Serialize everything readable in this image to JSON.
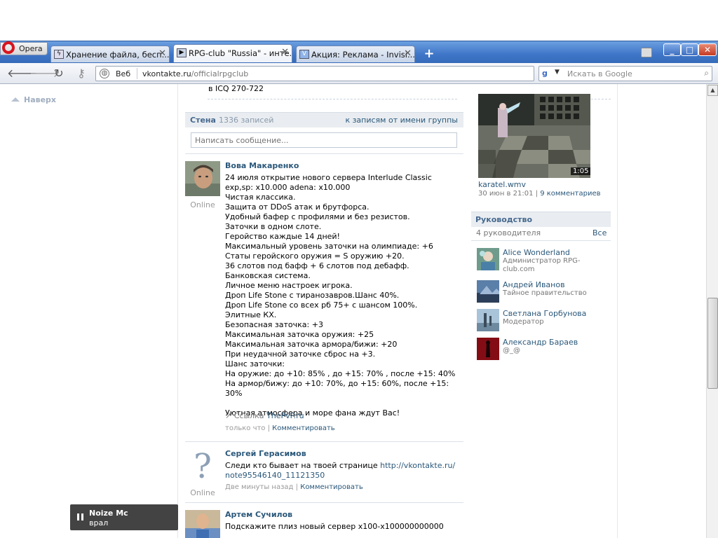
{
  "browser": {
    "menu_label": "Opera",
    "tabs": [
      {
        "title": "Хранение файла, бесп...",
        "favicon": "lightning-favicon-icon"
      },
      {
        "title": "RPG-club \"Russia\" - инте...",
        "favicon": "vk-favicon-icon"
      },
      {
        "title": "Акция: Реклама - Invisi...",
        "favicon": "v-favicon-icon"
      }
    ],
    "address": {
      "scheme_label": "Веб",
      "url_domain": "vkontakte.ru",
      "url_path": "/officialrpgclub"
    },
    "search_placeholder": "Искать в Google"
  },
  "page": {
    "back_to_top": "Наверх",
    "icq_line": "в ICQ 270-722",
    "wall": {
      "title": "Стена",
      "count": "1336 записей",
      "from_group_link": "к записям от имени группы",
      "input_placeholder": "Написать сообщение..."
    },
    "posts": [
      {
        "author": "Вова Макаренко",
        "status": "Online",
        "text": "24 июля открытие нового сервера Interlude Classic\nexp,sp: x10.000 adena: x10.000\nЧистая классика.\nЗащита от DDoS атак и брутфорса.\nУдобный бафер с профилями и без резистов.\nЗаточки в одном слоте.\nГеройство каждые 14 дней!\nМаксимальный уровень заточки на олимпиаде: +6\nСтаты геройского оружия = S оружию +20.\n36 слотов под бафф + 6 слотов под дебафф.\nБанковская система.\nЛичное меню настроек игрока.\nДроп Life Stone с тиранозавров.Шанс 40%.\nДроп Life Stone со всех рб 75+ с шансом 100%.\nЭлитные КХ.\nБезопасная заточка: +3\nМаксимальная заточка оружия: +25\nМаксимальная заточка армора/бижи: +20\nПри неудачной заточке сброс на +3.\nШанс заточки:\nНа оружие: до +10: 85% , до +15: 70% , после +15: 40%\nНа армор/бижу: до +10: 70%, до +15: 60%, после +15: 30%\n\nУютная атмосфера и море фана ждут Вас!",
        "link_label": "Ссылка",
        "link_text": "ThePvP.ru",
        "time": "только что",
        "comment": "Комментировать"
      },
      {
        "author": "Сергей Герасимов",
        "status": "Online",
        "text_before": "Следи кто бывает на твоей странице ",
        "link_url_line1": "http://vkontakte.ru/",
        "link_url_line2": "note95546140_11121350",
        "time": "Две минуты назад",
        "comment": "Комментировать"
      },
      {
        "author": "Артем Сучилов",
        "text": "Подскажите плиз новый сервер х100-х100000000000"
      }
    ],
    "video": {
      "title": "karatel.wmv",
      "duration": "1:05",
      "date": "30 июн в 21:01",
      "comments": "9 комментариев"
    },
    "leadership": {
      "title": "Руководство",
      "count": "4 руководителя",
      "all_link": "Все",
      "leaders": [
        {
          "name": "Alice Wonderland",
          "role": "Администратор RPG-club.com"
        },
        {
          "name": "Андрей Иванов",
          "role": "Тайное правительство"
        },
        {
          "name": "Светлана Горбунова",
          "role": "Модератор"
        },
        {
          "name": "Александр Бараев",
          "role": "@_@"
        }
      ]
    },
    "player": {
      "artist": "Noize Mc",
      "song": "врал"
    }
  }
}
